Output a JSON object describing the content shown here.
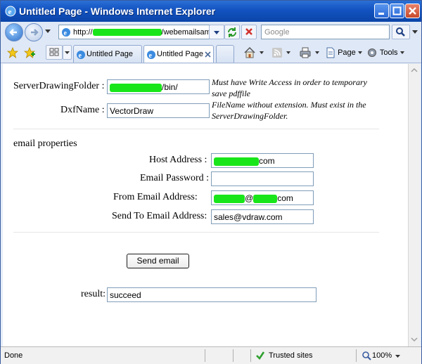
{
  "window": {
    "title": "Untitled Page - Windows Internet Explorer"
  },
  "address": {
    "url_prefix": "http://",
    "url_suffix": "/webemailsamp"
  },
  "search": {
    "placeholder": "Google"
  },
  "tabs": [
    {
      "label": "Untitled Page",
      "active": false
    },
    {
      "label": "Untitled Page",
      "active": true
    }
  ],
  "commands": {
    "page": "Page",
    "tools": "Tools"
  },
  "form": {
    "server_folder_label": "ServerDrawingFolder :",
    "server_folder_value_suffix": "/bin/",
    "server_folder_note": "Must have Write Access in order to temporary save pdffile",
    "dxf_name_label": "DxfName :",
    "dxf_name_value": "VectorDraw",
    "dxf_name_note": "FileName without extension. Must exist in the ServerDrawingFolder.",
    "email_section_title": "email properties",
    "host_label": "Host Address :",
    "host_value_suffix": "com",
    "password_label": "Email Password :",
    "password_value": "",
    "from_label": "From Email Address:",
    "from_value_middle": "@",
    "from_value_suffix": "com",
    "to_label": "Send To Email Address:",
    "to_value": "sales@vdraw.com",
    "send_button": "Send email",
    "result_label": "result:",
    "result_value": "succeed"
  },
  "status": {
    "left": "Done",
    "zone": "Trusted sites",
    "zoom": "100%"
  },
  "colors": {
    "titlebar": "#1252c0",
    "redaction": "#19e61a",
    "trusted_check": "#2fa02f"
  }
}
